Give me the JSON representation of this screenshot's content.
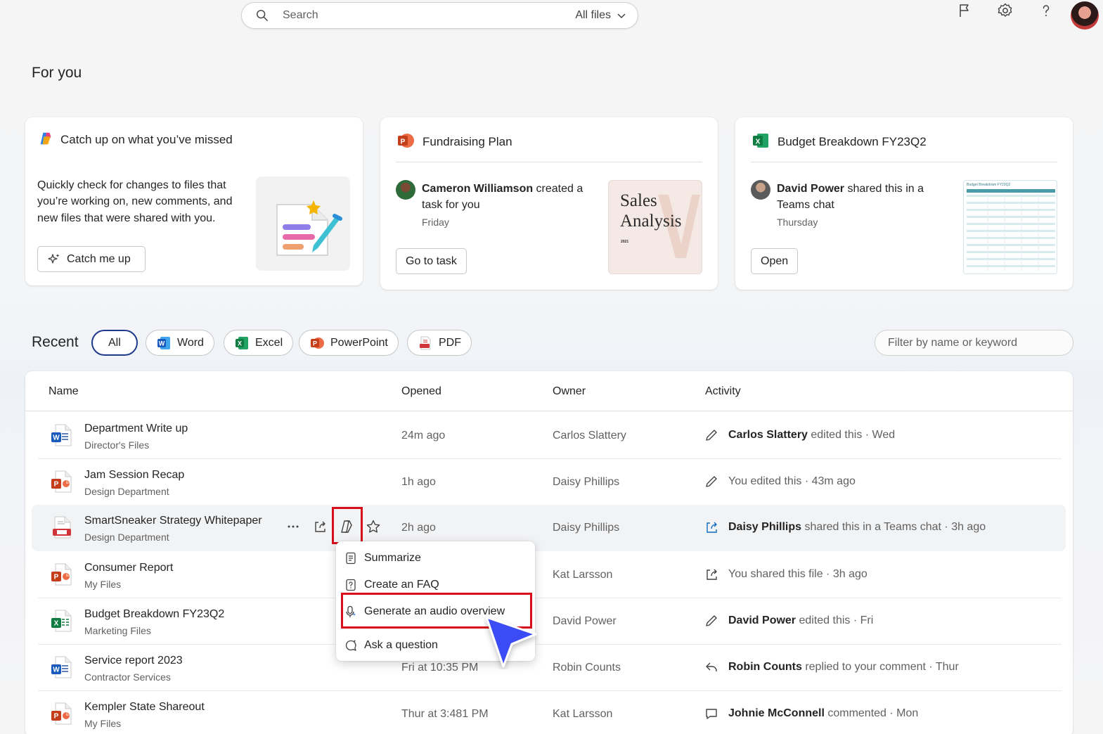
{
  "search": {
    "placeholder": "Search",
    "scope": "All files"
  },
  "header": {
    "title": "For you"
  },
  "cards": {
    "catchup": {
      "title": "Catch up on what you’ve missed",
      "body_line1": "Quickly check for changes to files that",
      "body_line2": "you’re working on, new comments, and",
      "body_line3": "new files that were shared with you.",
      "button": "Catch me up"
    },
    "fundraising": {
      "title": "Fundraising Plan",
      "person": "Cameron Williamson",
      "action_line1": " created a",
      "action_line2": "task for you",
      "when": "Friday",
      "button": "Go to task",
      "thumb_title_line1": "Sales",
      "thumb_title_line2": "Analysis",
      "thumb_year": "2021"
    },
    "budget": {
      "title": "Budget Breakdown FY23Q2",
      "person": "David Power",
      "action_line1": " shared this in a",
      "action_line2": "Teams chat",
      "when": "Thursday",
      "button": "Open",
      "thumb_title": "Budget Breakdown FY23Q2"
    }
  },
  "recent": {
    "label": "Recent",
    "filters": [
      "All",
      "Word",
      "Excel",
      "PowerPoint",
      "PDF"
    ],
    "filter_placeholder": "Filter by name or keyword",
    "columns": [
      "Name",
      "Opened",
      "Owner",
      "Activity"
    ],
    "rows": [
      {
        "name": "Department Write up",
        "location": "Director's Files",
        "opened": "24m ago",
        "owner": "Carlos Slattery",
        "activity_who": "Carlos Slattery",
        "activity_text": " edited this · Wed",
        "type": "word",
        "act_icon": "pencil-icon"
      },
      {
        "name": "Jam Session Recap",
        "location": "Design Department",
        "opened": "1h ago",
        "owner": "Daisy Phillips",
        "activity_who": "",
        "activity_text": "You edited this · 43m ago",
        "type": "powerpoint",
        "act_icon": "pencil-icon"
      },
      {
        "name": "SmartSneaker Strategy Whitepaper",
        "location": "Design Department",
        "opened": "2h ago",
        "owner": "Daisy Phillips",
        "activity_who": "Daisy Phillips",
        "activity_text": " shared this in a Teams chat · 3h ago",
        "type": "pdf",
        "act_icon": "share-icon"
      },
      {
        "name": "Consumer Report",
        "location": "My Files",
        "opened": "",
        "owner": "Kat Larsson",
        "activity_who": "",
        "activity_text": "You shared this file · 3h ago",
        "type": "powerpoint",
        "act_icon": "share-icon"
      },
      {
        "name": "Budget Breakdown FY23Q2",
        "location": "Marketing Files",
        "opened": "",
        "owner": "David Power",
        "activity_who": "David Power",
        "activity_text": " edited this · Fri",
        "type": "excel",
        "act_icon": "pencil-icon"
      },
      {
        "name": "Service report 2023",
        "location": "Contractor Services",
        "opened": "Fri at 10:35 PM",
        "owner": "Robin Counts",
        "activity_who": "Robin Counts",
        "activity_text": " replied to your comment · Thur",
        "type": "word",
        "act_icon": "reply-icon"
      },
      {
        "name": "Kempler State Shareout",
        "location": "My Files",
        "opened": "Thur at 3:481 PM",
        "owner": "Kat Larsson",
        "activity_who": "Johnie McConnell",
        "activity_text": " commented · Mon",
        "type": "powerpoint",
        "act_icon": "comment-icon"
      }
    ]
  },
  "copilot_menu": {
    "items": [
      "Summarize",
      "Create an FAQ",
      "Generate an audio overview",
      "Ask a question"
    ]
  },
  "colors": {
    "word": "#185abd",
    "excel": "#107c41",
    "powerpoint": "#c43e1c",
    "pdf": "#d13438",
    "highlight": "#d80f1a",
    "active_pill": "#1f3a8c",
    "cursor": "#3b4bf5"
  }
}
